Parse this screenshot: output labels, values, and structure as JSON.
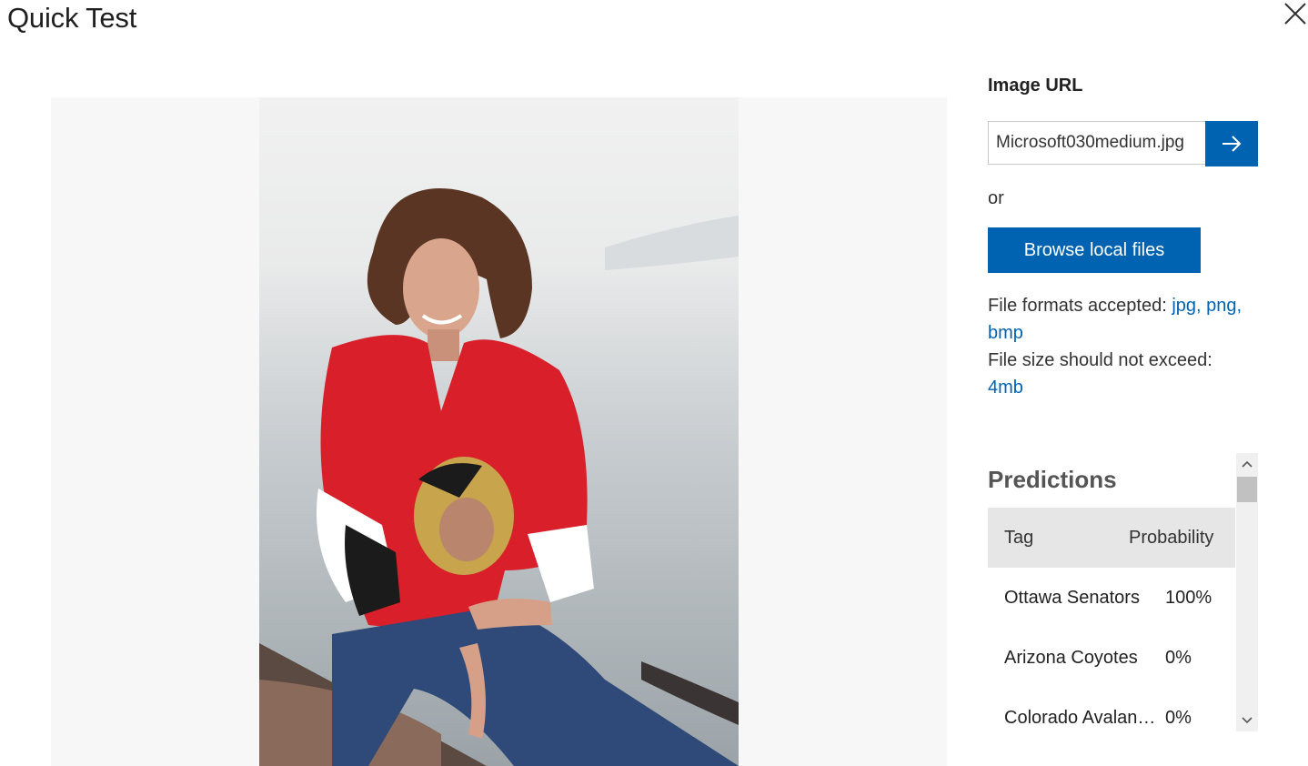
{
  "title": "Quick Test",
  "close_icon": "close-icon",
  "image_url": {
    "label": "Image URL",
    "value": "Microsoft030medium.jpg",
    "go_icon": "arrow-right-icon"
  },
  "or_text": "or",
  "browse_label": "Browse local files",
  "info": {
    "formats_label": "File formats accepted:",
    "formats": "jpg, png, bmp",
    "size_label": "File size should not exceed:",
    "size": "4mb"
  },
  "predictions": {
    "title": "Predictions",
    "columns": [
      "Tag",
      "Probability"
    ],
    "rows": [
      {
        "tag": "Ottawa Senators",
        "probability": "100%"
      },
      {
        "tag": "Arizona Coyotes",
        "probability": "0%"
      },
      {
        "tag": "Colorado Avalanche",
        "probability": "0%"
      }
    ]
  },
  "colors": {
    "accent": "#0063b1",
    "link": "#0063b1",
    "header_bg": "#e6e6e6"
  }
}
